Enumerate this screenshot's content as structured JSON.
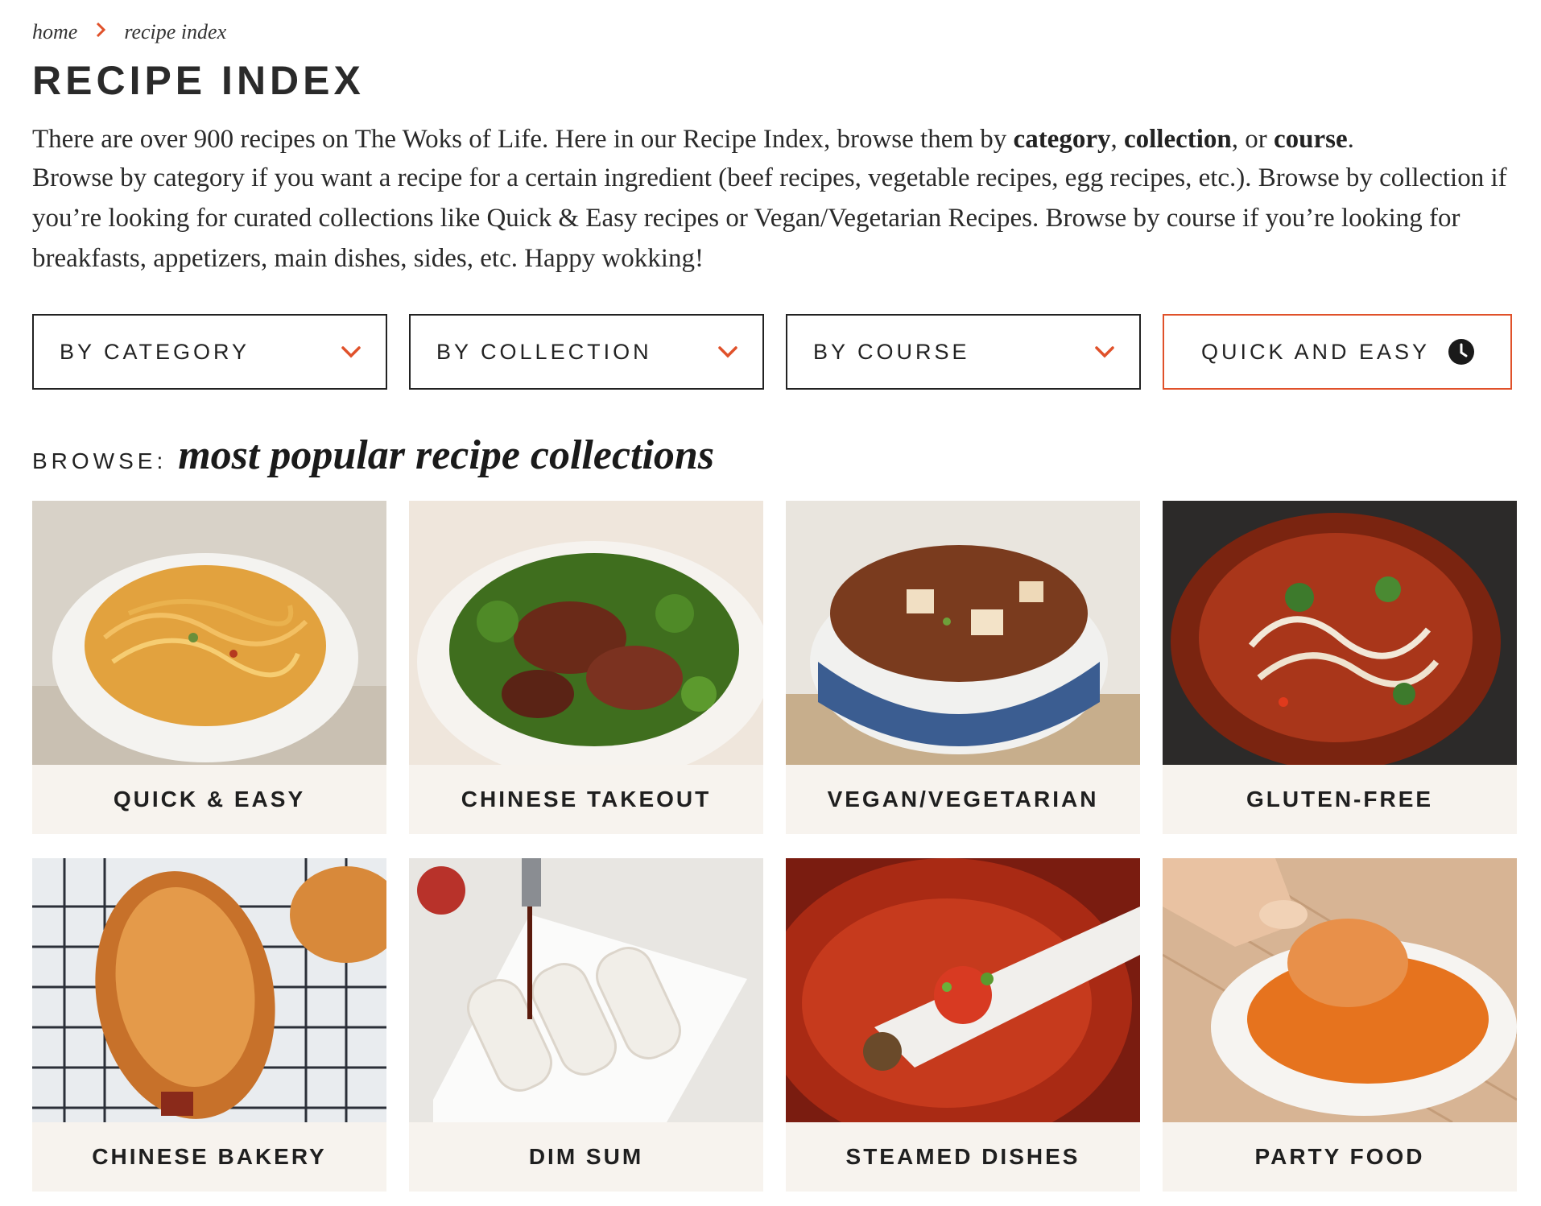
{
  "breadcrumb": {
    "home": "home",
    "separator": "›",
    "current": "recipe index"
  },
  "page_title": "RECIPE INDEX",
  "intro": {
    "line1_pre": "There are over 900 recipes on The Woks of Life. Here in our Recipe Index, browse them by ",
    "line1_category": "category",
    "line1_comma": ", ",
    "line1_collection": "collection",
    "line1_or": ", or ",
    "line1_course": "course",
    "line1_end": ".",
    "paragraph2": "Browse by category if you want a recipe for a certain ingredient (beef recipes, vegetable recipes, egg recipes, etc.). Browse by collection if you’re looking for curated collections like Quick & Easy recipes or Vegan/Vegetarian Recipes. Browse by course if you’re looking for breakfasts, appetizers, main dishes, sides, etc. Happy wokking!"
  },
  "filters": {
    "by_category": "BY CATEGORY",
    "by_collection": "BY COLLECTION",
    "by_course": "BY COURSE",
    "quick_and_easy": "QUICK AND EASY"
  },
  "browse": {
    "kicker": "BROWSE:",
    "headline": "most popular recipe collections"
  },
  "collections": [
    {
      "label": "QUICK & EASY"
    },
    {
      "label": "CHINESE TAKEOUT"
    },
    {
      "label": "VEGAN/VEGETARIAN"
    },
    {
      "label": "GLUTEN-FREE"
    },
    {
      "label": "CHINESE BAKERY"
    },
    {
      "label": "DIM SUM"
    },
    {
      "label": "STEAMED DISHES"
    },
    {
      "label": "PARTY FOOD"
    }
  ],
  "colors": {
    "accent": "#e0512a",
    "caption_bg": "#f7f3ee",
    "text": "#222222"
  },
  "icons": [
    "chevron-right-icon",
    "chevron-down-icon",
    "clock-icon"
  ]
}
